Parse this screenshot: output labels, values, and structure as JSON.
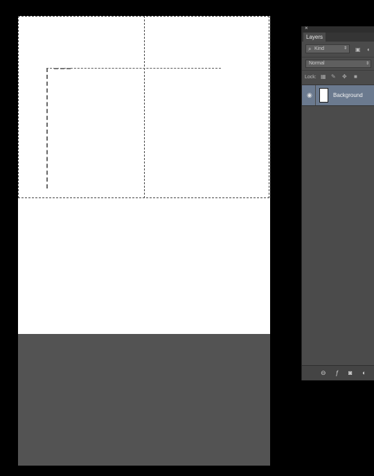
{
  "canvas": {
    "background": "#ffffff",
    "lower_region_color": "#535353"
  },
  "layers_panel": {
    "close_glyph": "×",
    "tab_label": "Layers",
    "filter": {
      "search_glyph": "⌕",
      "kind_label": "Kind",
      "updown_glyph": "⇕",
      "icons": [
        "image-filter-icon",
        "adjustment-filter-icon"
      ]
    },
    "blend_mode": {
      "value": "Normal",
      "updown_glyph": "⇕"
    },
    "lock": {
      "label": "Lock:",
      "icons": [
        "lock-transparency-icon",
        "lock-image-pixels-icon",
        "lock-position-icon",
        "lock-all-icon"
      ]
    },
    "layers": [
      {
        "name": "Background",
        "visible": true,
        "selected": true
      }
    ],
    "footer_icons": [
      "link-layers-icon",
      "fx-icon",
      "add-mask-icon",
      "new-adjustment-layer-icon"
    ],
    "selected_row_color": "#6b7a8f"
  }
}
